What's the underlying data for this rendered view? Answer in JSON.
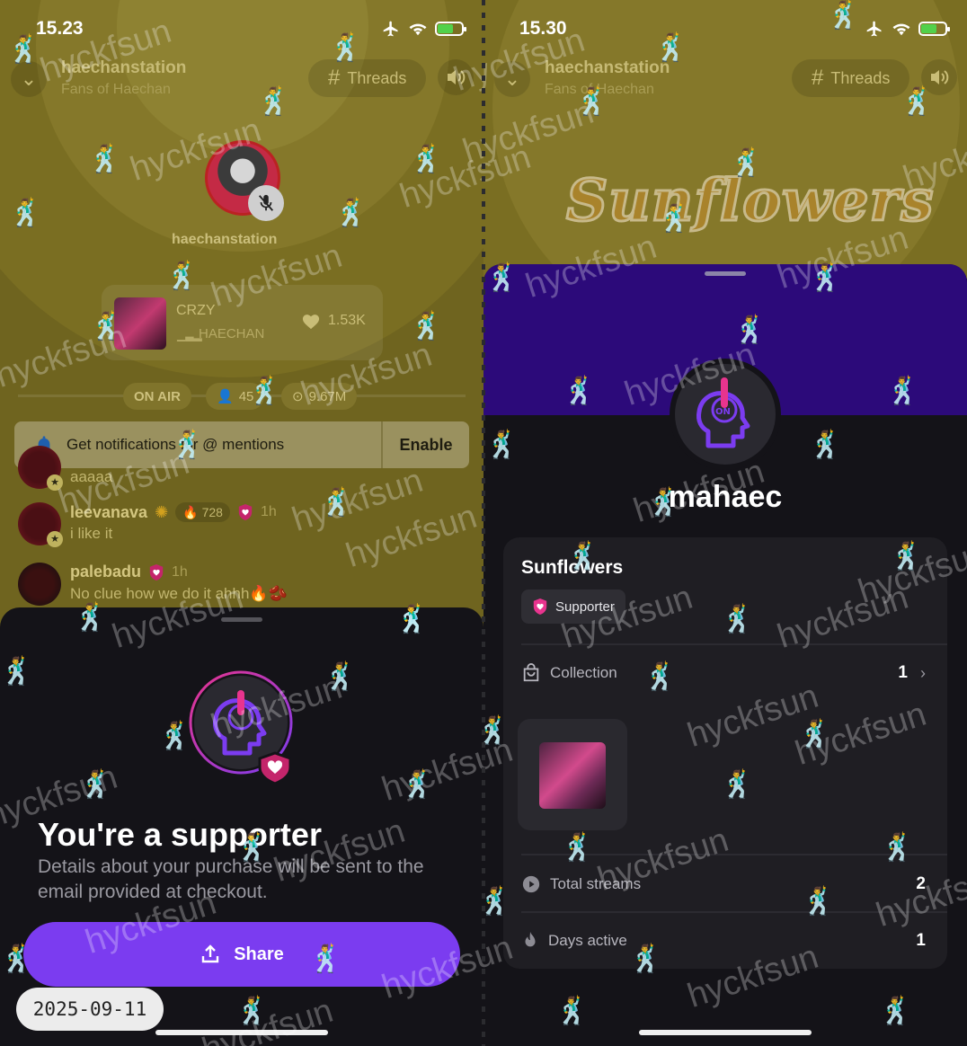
{
  "left": {
    "status": {
      "time": "15.23"
    },
    "header": {
      "station": "haechanstation",
      "subtitle": "Fans of Haechan",
      "threads_label": "Threads"
    },
    "host": {
      "name": "haechanstation"
    },
    "now_playing": {
      "title": "CRZY",
      "artist": "HAECHAN",
      "likes": "1.53K"
    },
    "stats": {
      "on_air": "ON AIR",
      "listeners": "45",
      "plays": "9.67M"
    },
    "notification": {
      "message": "Get notifications for @ mentions",
      "action": "Enable"
    },
    "chat": [
      {
        "user": "",
        "message": "aaaaa"
      },
      {
        "user": "leevanava",
        "points": "728",
        "time": "1h",
        "message": "i like it"
      },
      {
        "user": "palebadu",
        "time": "1h",
        "message": "No clue how we do it ahhh🔥🫘"
      }
    ],
    "sheet": {
      "title": "You're a supporter",
      "description": "Details about your purchase will be sent to the email provided at checkout.",
      "share_label": "Share"
    },
    "date_chip": "2025-09-11"
  },
  "right": {
    "status": {
      "time": "15.30"
    },
    "header": {
      "station": "haechanstation",
      "subtitle": "Fans of Haechan",
      "threads_label": "Threads"
    },
    "banner_logo": "Sunflowers",
    "profile": {
      "username": "mahaec"
    },
    "card": {
      "station_title": "Sunflowers",
      "badge": "Supporter",
      "collection_label": "Collection",
      "collection_count": "1",
      "total_streams_label": "Total streams",
      "total_streams": "2",
      "days_active_label": "Days active",
      "days_active": "1"
    }
  },
  "watermark": "hyckfsun",
  "colors": {
    "accent_purple": "#7b3cf0",
    "station_gold": "#6f641f",
    "banner_purple": "#2c0a7a",
    "supporter_pink": "#e8348e"
  }
}
